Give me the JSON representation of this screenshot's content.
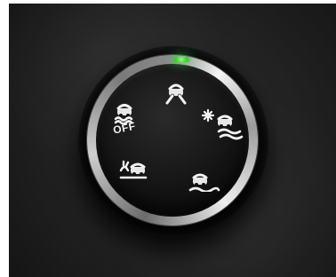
{
  "control": {
    "off_label": "OFF"
  },
  "colors": {
    "icon": "#f2f2f2",
    "indicator": "#2bd42c",
    "chrome": "#d9d9d9",
    "leather": "#1c1c1c"
  },
  "icons": {
    "top": "road-mode-icon",
    "left": "traction-control-icon",
    "right": "snow-mode-icon",
    "bottom_left": "mud-mode-icon",
    "bottom_right": "sand-mode-icon"
  }
}
